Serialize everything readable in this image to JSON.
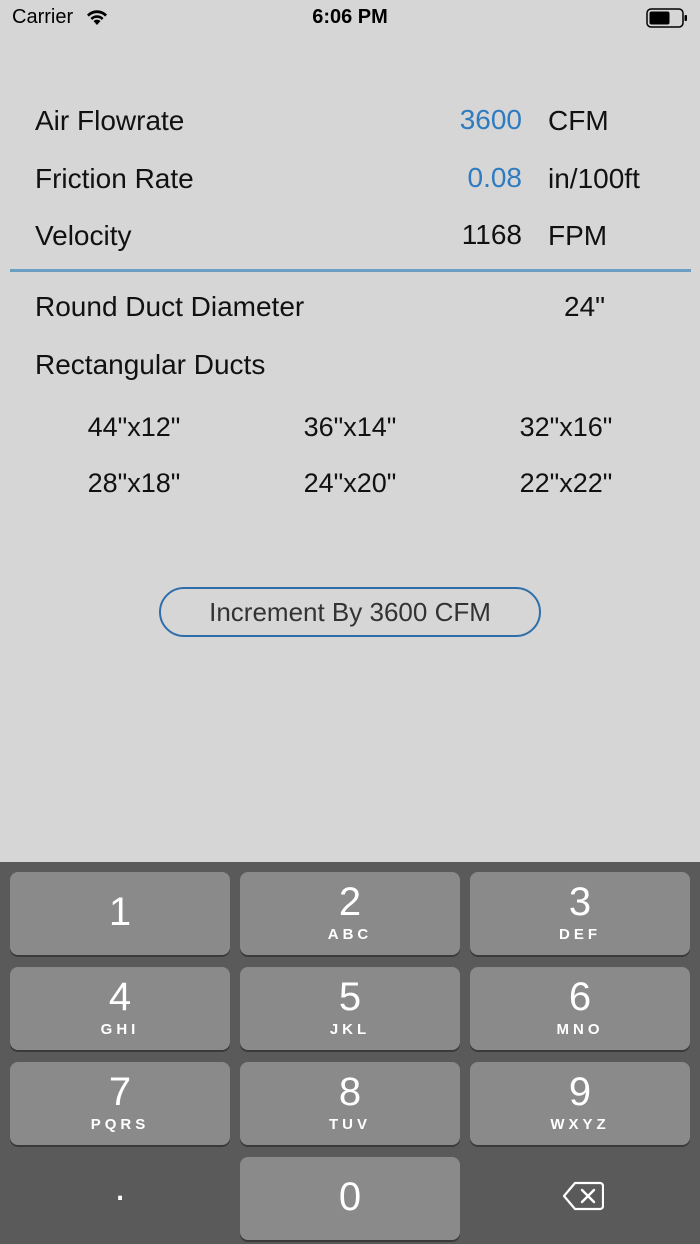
{
  "status_bar": {
    "carrier": "Carrier",
    "time": "6:06 PM"
  },
  "inputs": {
    "air_flowrate": {
      "label": "Air Flowrate",
      "value": "3600",
      "unit": "CFM"
    },
    "friction_rate": {
      "label": "Friction Rate",
      "value": "0.08",
      "unit": "in/100ft"
    },
    "velocity": {
      "label": "Velocity",
      "value": "1168",
      "unit": "FPM"
    }
  },
  "results": {
    "round_label": "Round Duct Diameter",
    "round_value": "24\"",
    "rect_label": "Rectangular Ducts",
    "rect_ducts": [
      "44\"x12\"",
      "36\"x14\"",
      "32\"x16\"",
      "28\"x18\"",
      "24\"x20\"",
      "22\"x22\""
    ]
  },
  "increment_button": "Increment By 3600 CFM",
  "keyboard": {
    "keys": [
      {
        "digit": "1",
        "letters": ""
      },
      {
        "digit": "2",
        "letters": "ABC"
      },
      {
        "digit": "3",
        "letters": "DEF"
      },
      {
        "digit": "4",
        "letters": "GHI"
      },
      {
        "digit": "5",
        "letters": "JKL"
      },
      {
        "digit": "6",
        "letters": "MNO"
      },
      {
        "digit": "7",
        "letters": "PQRS"
      },
      {
        "digit": "8",
        "letters": "TUV"
      },
      {
        "digit": "9",
        "letters": "WXYZ"
      }
    ],
    "decimal": ".",
    "zero": "0"
  },
  "colors": {
    "accent": "#2f7bbf",
    "background": "#d6d6d6",
    "keyboard_bg": "#5a5a5a",
    "key_bg": "#8a8a8a"
  },
  "icons": [
    "wifi-icon",
    "battery-icon",
    "backspace-icon"
  ]
}
